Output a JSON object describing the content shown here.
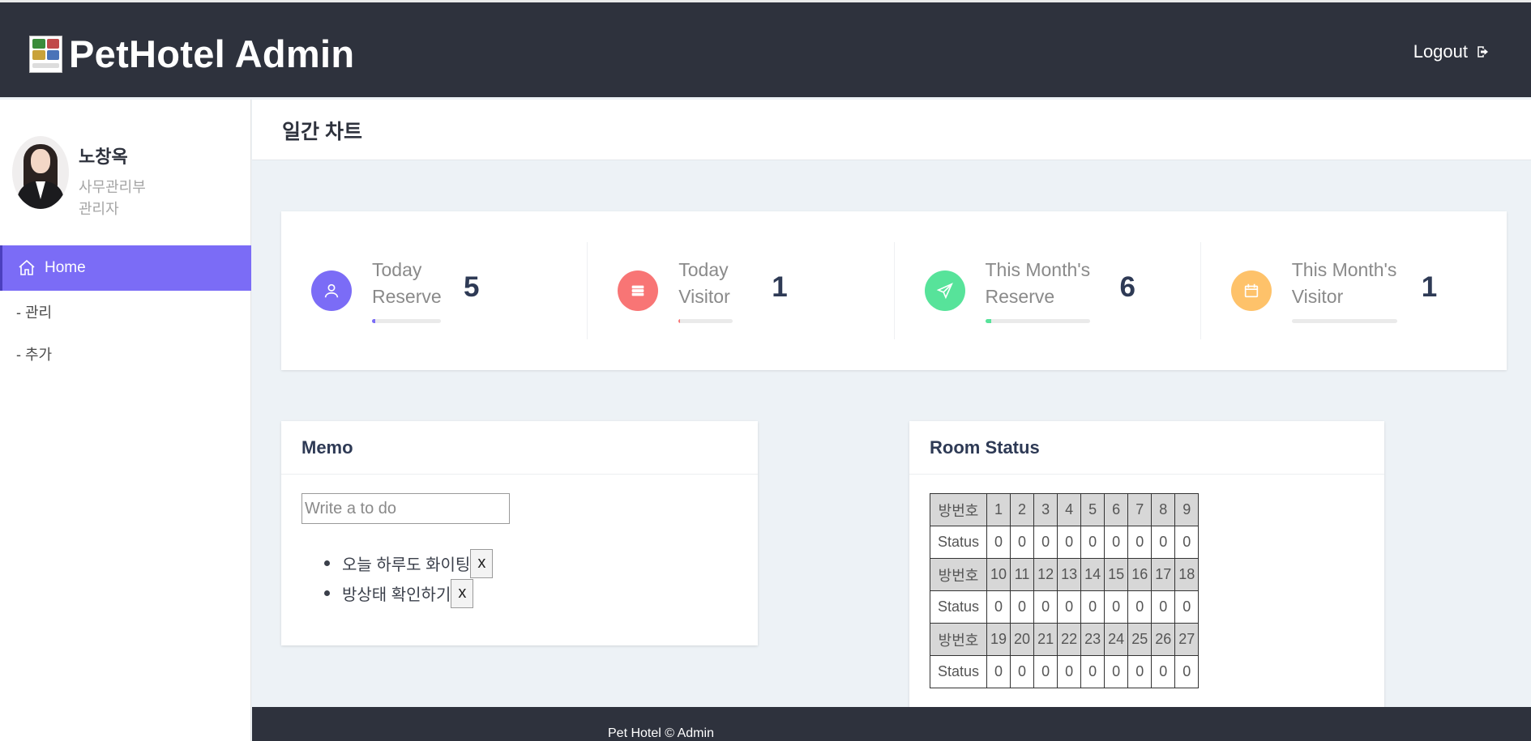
{
  "header": {
    "brand_title": "PetHotel Admin",
    "logout_label": "Logout"
  },
  "profile": {
    "name": "노창옥",
    "department": "사무관리부",
    "role": "관리자"
  },
  "nav": {
    "home_label": "Home",
    "items": [
      "- 관리",
      "- 추가"
    ]
  },
  "page": {
    "title": "일간 차트"
  },
  "stats": [
    {
      "label_line1": "Today",
      "label_line2": "Reserve",
      "value": "5",
      "icon": "user-icon",
      "color": "#7b6cf6",
      "progress": 0.05
    },
    {
      "label_line1": "Today",
      "label_line2": "Visitor",
      "value": "1",
      "icon": "server-icon",
      "color": "#f87575",
      "progress": 0.02
    },
    {
      "label_line1": "This Month's",
      "label_line2": "Reserve",
      "value": "6",
      "icon": "send-icon",
      "color": "#57e39a",
      "progress": 0.06
    },
    {
      "label_line1": "This Month's",
      "label_line2": "Visitor",
      "value": "1",
      "icon": "calendar-icon",
      "color": "#fec26a",
      "progress": 0.0
    }
  ],
  "memo": {
    "title": "Memo",
    "input_placeholder": "Write a to do",
    "todos": [
      "오늘 하루도 화이팅",
      "방상태 확인하기"
    ],
    "delete_label": "x"
  },
  "room_status": {
    "title": "Room Status",
    "room_label": "방번호",
    "status_label": "Status",
    "rows": [
      {
        "rooms": [
          "1",
          "2",
          "3",
          "4",
          "5",
          "6",
          "7",
          "8",
          "9"
        ],
        "status": [
          "0",
          "0",
          "0",
          "0",
          "0",
          "0",
          "0",
          "0",
          "0"
        ]
      },
      {
        "rooms": [
          "10",
          "11",
          "12",
          "13",
          "14",
          "15",
          "16",
          "17",
          "18"
        ],
        "status": [
          "0",
          "0",
          "0",
          "0",
          "0",
          "0",
          "0",
          "0",
          "0"
        ]
      },
      {
        "rooms": [
          "19",
          "20",
          "21",
          "22",
          "23",
          "24",
          "25",
          "26",
          "27"
        ],
        "status": [
          "0",
          "0",
          "0",
          "0",
          "0",
          "0",
          "0",
          "0",
          "0"
        ]
      }
    ]
  },
  "footer": {
    "text": "Pet Hotel © Admin"
  }
}
